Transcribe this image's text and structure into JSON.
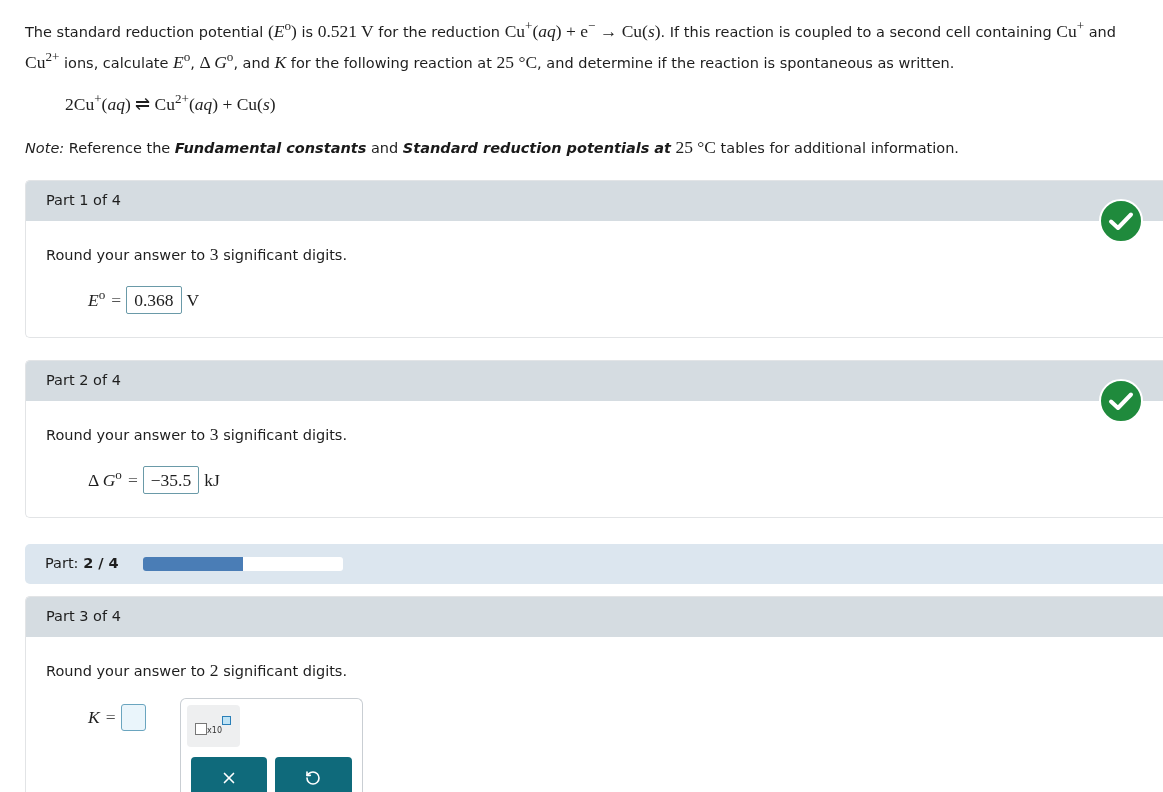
{
  "problem": {
    "statement": [
      {
        "kind": "text",
        "text": "The standard reduction potential "
      },
      {
        "kind": "math",
        "text": "(*E*$^{o}$)"
      },
      {
        "kind": "text",
        "text": " is "
      },
      {
        "kind": "math",
        "text": "0.521 V"
      },
      {
        "kind": "text",
        "text": " for the reduction "
      },
      {
        "kind": "math",
        "text": "Cu$^{+}$(*aq*) + e$^{−}$ → Cu(*s*)"
      },
      {
        "kind": "text",
        "text": ". If this reaction is coupled to a second cell containing "
      },
      {
        "kind": "math",
        "text": "Cu$^{+}$"
      },
      {
        "kind": "text",
        "text": " and "
      },
      {
        "kind": "math",
        "text": "Cu$^{2+}$"
      },
      {
        "kind": "text",
        "text": " ions, calculate "
      },
      {
        "kind": "math",
        "text": "*E*$^{o}$"
      },
      {
        "kind": "text",
        "text": ", "
      },
      {
        "kind": "math",
        "text": "Δ *G*$^{o}$"
      },
      {
        "kind": "text",
        "text": ", and "
      },
      {
        "kind": "math",
        "text": "*K*"
      },
      {
        "kind": "text",
        "text": " for the following reaction at "
      },
      {
        "kind": "math",
        "text": "25 °C"
      },
      {
        "kind": "text",
        "text": ", and determine if the reaction is spontaneous as written."
      }
    ],
    "equation": "2Cu$^{+}$(*aq*) ⇌ Cu$^{2+}$(*aq*) + Cu(*s*)",
    "note": [
      {
        "kind": "text",
        "text": "*Note:* Reference the "
      },
      {
        "kind": "link",
        "text": "Fundamental constants"
      },
      {
        "kind": "text",
        "text": " and "
      },
      {
        "kind": "link",
        "text": "Standard reduction potentials at"
      },
      {
        "kind": "math",
        "text": " 25 °C"
      },
      {
        "kind": "text",
        "text": " tables for additional information."
      }
    ]
  },
  "sections": [
    {
      "kind": "part",
      "title": "Part 1 of 4",
      "correct": true,
      "instruction": [
        {
          "kind": "text",
          "text": "Round your answer to "
        },
        {
          "kind": "math",
          "text": "3"
        },
        {
          "kind": "text",
          "text": " significant digits."
        }
      ],
      "answer": {
        "label": "*E*$^{o}$",
        "sign": "=",
        "value": "0.368",
        "unit": "V"
      }
    },
    {
      "kind": "part",
      "title": "Part 2 of 4",
      "correct": true,
      "instruction": [
        {
          "kind": "text",
          "text": "Round your answer to "
        },
        {
          "kind": "math",
          "text": "3"
        },
        {
          "kind": "text",
          "text": " significant digits."
        }
      ],
      "answer": {
        "label": "Δ *G*$^{o}$",
        "sign": "=",
        "value": "−35.5",
        "unit": "kJ"
      }
    },
    {
      "kind": "progress",
      "label": "Part: **2 / 4**",
      "level": 0.5
    },
    {
      "kind": "part",
      "title": "Part 3 of 4",
      "correct": false,
      "instruction": [
        {
          "kind": "text",
          "text": "Round your answer to "
        },
        {
          "kind": "math",
          "text": "2"
        },
        {
          "kind": "text",
          "text": " significant digits."
        }
      ],
      "answer": {
        "label": "*K*",
        "sign": "="
      },
      "palette": {
        "template_label": "x10",
        "tools": [
          {
            "kind": "clear"
          },
          {
            "kind": "undo"
          }
        ]
      }
    }
  ]
}
